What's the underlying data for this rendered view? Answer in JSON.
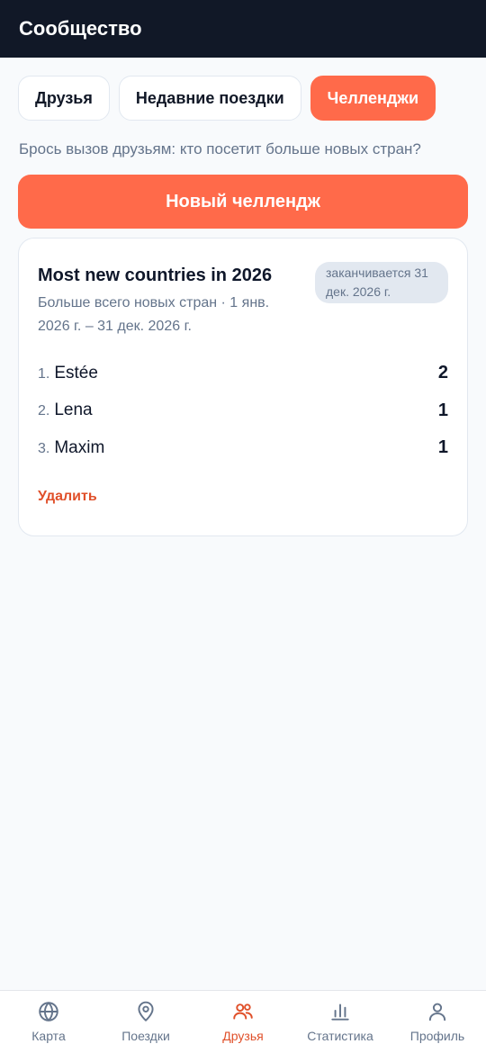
{
  "header": {
    "title": "Сообщество"
  },
  "tabs": [
    {
      "label": "Друзья"
    },
    {
      "label": "Недавние поездки"
    },
    {
      "label": "Челленджи",
      "active": true
    }
  ],
  "hint": "Брось вызов друзьям: кто посетит больше новых стран?",
  "new_challenge_label": "Новый челлендж",
  "challenge": {
    "title": "Most new countries in 2026",
    "subtitle": "Больше всего новых стран · 1 янв. 2026 г. – 31 дек. 2026 г.",
    "badge": "заканчивается 31 дек. 2026 г.",
    "leaderboard": [
      {
        "rank": "1.",
        "name": "Estée",
        "score": "2"
      },
      {
        "rank": "2.",
        "name": "Lena",
        "score": "1"
      },
      {
        "rank": "3.",
        "name": "Maxim",
        "score": "1"
      }
    ],
    "delete_label": "Удалить"
  },
  "nav": {
    "items": [
      {
        "label": "Карта",
        "icon": "globe-icon"
      },
      {
        "label": "Поездки",
        "icon": "map-pin-icon"
      },
      {
        "label": "Друзья",
        "icon": "users-icon",
        "active": true
      },
      {
        "label": "Статистика",
        "icon": "bar-chart-icon"
      },
      {
        "label": "Профиль",
        "icon": "user-icon"
      }
    ]
  },
  "colors": {
    "accent": "#ff6a4a",
    "header_bg": "#111827",
    "active_nav": "#e0502a",
    "muted": "#64748b"
  }
}
